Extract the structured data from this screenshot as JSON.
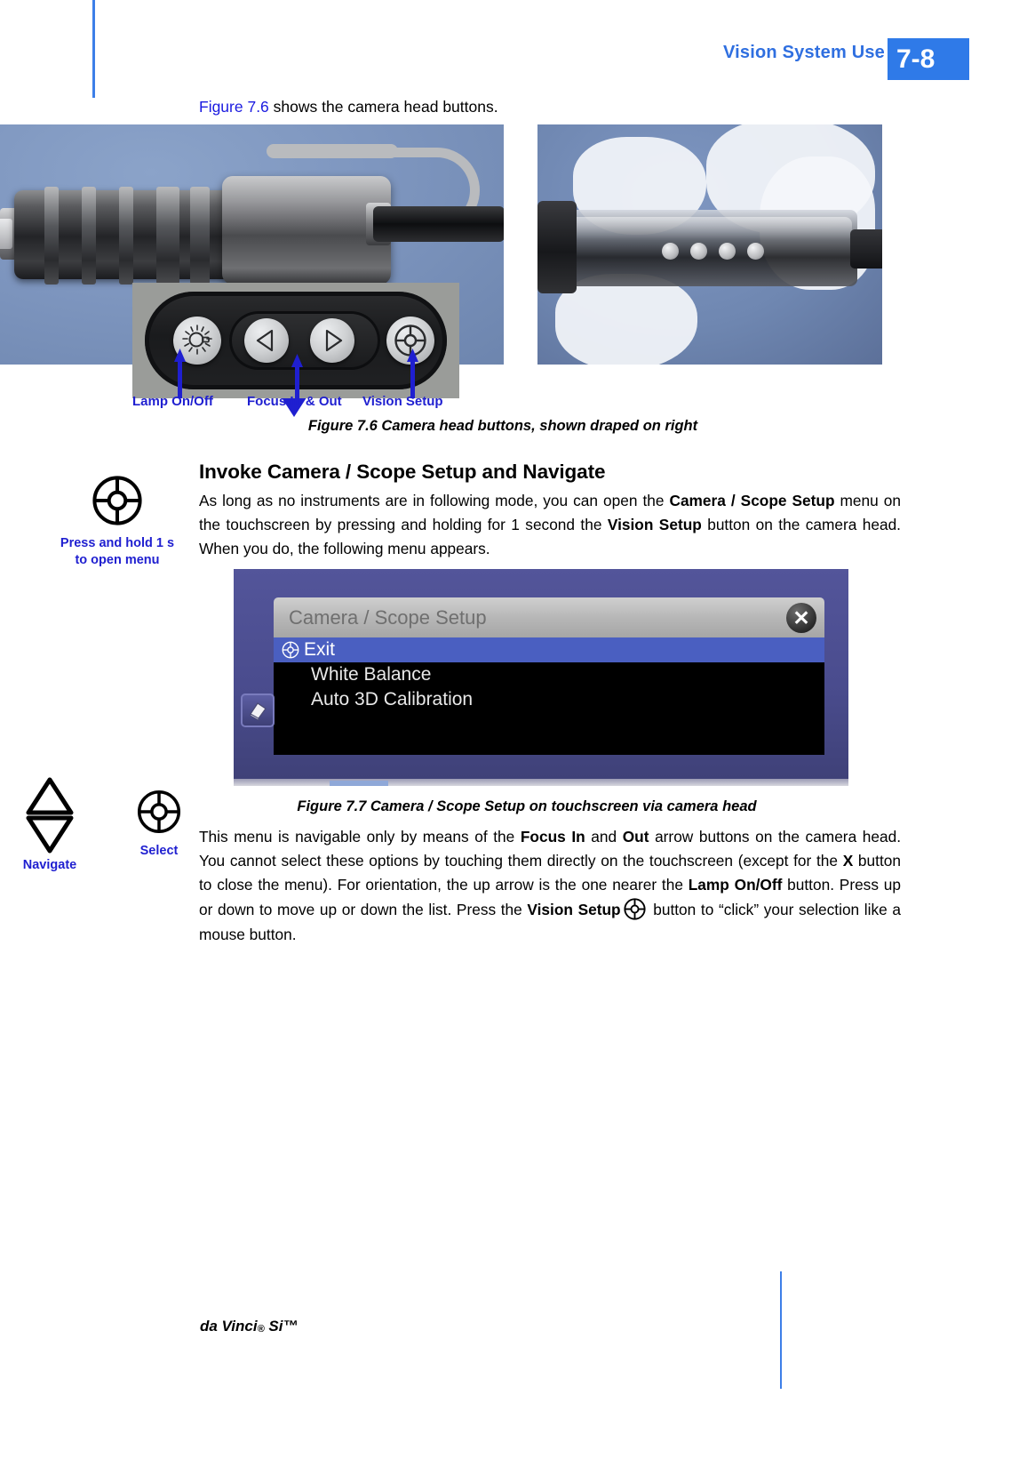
{
  "header": {
    "title": "Vision System Use",
    "page_number": "7-8"
  },
  "intro": {
    "xref": "Figure 7.6",
    "rest": " shows the camera head buttons."
  },
  "figure_76": {
    "callouts": [
      {
        "label": "Lamp On/Off"
      },
      {
        "label": "Focus In & Out"
      },
      {
        "label": "Vision Setup"
      }
    ],
    "caption": "Figure 7.6 Camera head buttons, shown draped on right"
  },
  "section": {
    "heading": "Invoke Camera / Scope Setup and Navigate",
    "paragraph1": {
      "part1": "As long as no instruments are in following mode, you can open the ",
      "bold1": "Camera / Scope Setup",
      "part2": " menu on the touchscreen by pressing and holding for 1 second the ",
      "bold2": "Vision Setup",
      "part3": " button on the camera head. When you do, the following menu appears."
    },
    "paragraph2": {
      "part1": "This menu is navigable only by means of the ",
      "bold1": "Focus In",
      "part2": " and ",
      "bold2": "Out",
      "part3": " arrow buttons on the camera head. You cannot select these options by touching them directly on the touchscreen (except for the ",
      "bold3": "X",
      "part4": " button to close the menu). For orientation, the up arrow is the one nearer the ",
      "bold4": "Lamp On/Off",
      "part5": " button. Press up or down to move up or down the list. Press the ",
      "bold5": "Vision Setup",
      "part6": " button to “click” your selection like a mouse button."
    }
  },
  "margin_notes": {
    "press_hold": "Press and hold 1 s\nto open menu",
    "press_hold_line1": "Press and hold 1 s",
    "press_hold_line2": "to open menu",
    "navigate": "Navigate",
    "select": "Select"
  },
  "touchscreen": {
    "window_title": "Camera / Scope Setup",
    "close_label": "✕",
    "menu_items": [
      {
        "label": "Exit",
        "selected": true,
        "has_icon": true
      },
      {
        "label": "White Balance",
        "selected": false,
        "has_icon": false
      },
      {
        "label": "Auto 3D Calibration",
        "selected": false,
        "has_icon": false
      }
    ],
    "caption": "Figure 7.7 Camera / Scope Setup on touchscreen via camera head"
  },
  "footer": {
    "product": "da Vinci",
    "registered": "®",
    "model": " Si™"
  },
  "colors": {
    "accent_blue": "#2f7ae8",
    "link_blue": "#1a1ae0",
    "callout_blue": "#1f1fd0",
    "menu_highlight": "#4a5fc1",
    "touchscreen_bg": "#4c4e8d"
  }
}
